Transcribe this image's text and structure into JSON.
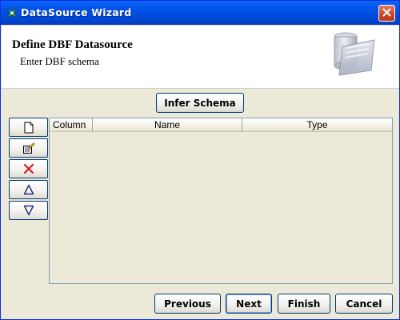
{
  "window": {
    "title": "DataSource Wizard"
  },
  "header": {
    "title": "Define DBF Datasource",
    "subtitle": "Enter DBF schema"
  },
  "toolbar": {
    "infer_schema_label": "Infer Schema"
  },
  "side_toolbar": {
    "items": [
      {
        "icon": "new-document-icon"
      },
      {
        "icon": "edit-properties-icon"
      },
      {
        "icon": "delete-icon"
      },
      {
        "icon": "move-up-icon"
      },
      {
        "icon": "move-down-icon"
      }
    ]
  },
  "table": {
    "columns": [
      "Column",
      "Name",
      "Type"
    ],
    "rows": []
  },
  "footer": {
    "previous_label": "Previous",
    "next_label": "Next",
    "finish_label": "Finish",
    "cancel_label": "Cancel"
  },
  "colors": {
    "titlebar": "#0050e5",
    "window_bg": "#ece9d8",
    "button_border": "#003c74",
    "delete_red": "#d81e1e"
  }
}
